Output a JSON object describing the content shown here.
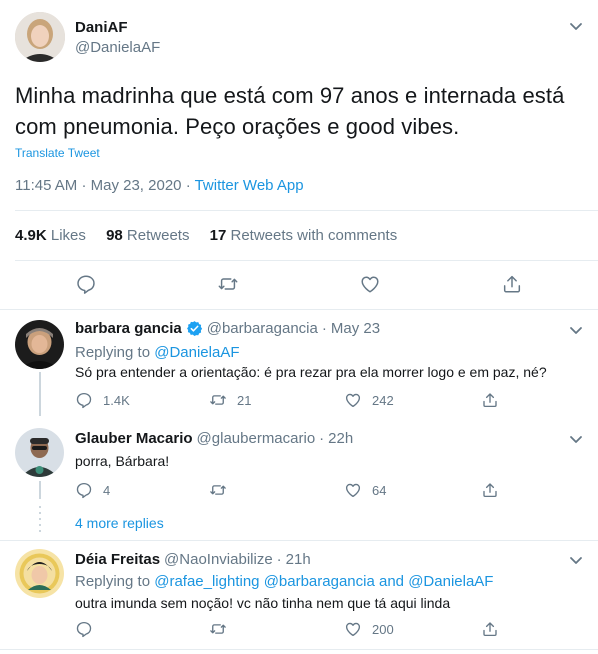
{
  "main_tweet": {
    "display_name": "DaniAF",
    "handle": "@DanielaAF",
    "text_line1": "Minha madrinha que está com 97 anos e internada está",
    "text_line2": "com pneumonia. Peço orações e good vibes.",
    "translate_label": "Translate Tweet",
    "time": "11:45 AM",
    "separator": "·",
    "date": "May 23, 2020",
    "source": "Twitter Web App",
    "likes_count": "4.9K",
    "likes_label": "Likes",
    "retweets_count": "98",
    "retweets_label": "Retweets",
    "quotes_count": "17",
    "quotes_label": "Retweets with comments"
  },
  "replies": [
    {
      "display_name": "barbara gancia",
      "verified": true,
      "handle": "@barbaragancia",
      "dot": "·",
      "date": "May 23",
      "replying_label": "Replying to",
      "replying_to": "@DanielaAF",
      "text": "Só pra entender a orientação: é pra rezar pra ela morrer logo e em paz, né?",
      "reply_count": "1.4K",
      "retweet_count": "21",
      "like_count": "242"
    },
    {
      "display_name": "Glauber Macario",
      "handle": "@glaubermacario",
      "dot": "·",
      "date": "22h",
      "text": "porra, Bárbara!",
      "reply_count": "4",
      "retweet_count": "",
      "like_count": "64"
    },
    {
      "display_name": "Déia Freitas",
      "handle": "@NaoInviabilize",
      "dot": "·",
      "date": "21h",
      "replying_label": "Replying to",
      "replying_to_1": "@rafae_lighting",
      "replying_to_2": "@barbaragancia",
      "replying_and": "and",
      "replying_to_3": "@DanielaAF",
      "text": "outra imunda sem noção! vc não tinha nem que tá aqui linda",
      "reply_count": "",
      "retweet_count": "",
      "like_count": "200"
    }
  ],
  "more_replies_label": "4 more replies",
  "colors": {
    "link": "#1b95e0",
    "muted": "#657786",
    "divider": "#e6ecf0",
    "verified": "#1da1f2"
  }
}
